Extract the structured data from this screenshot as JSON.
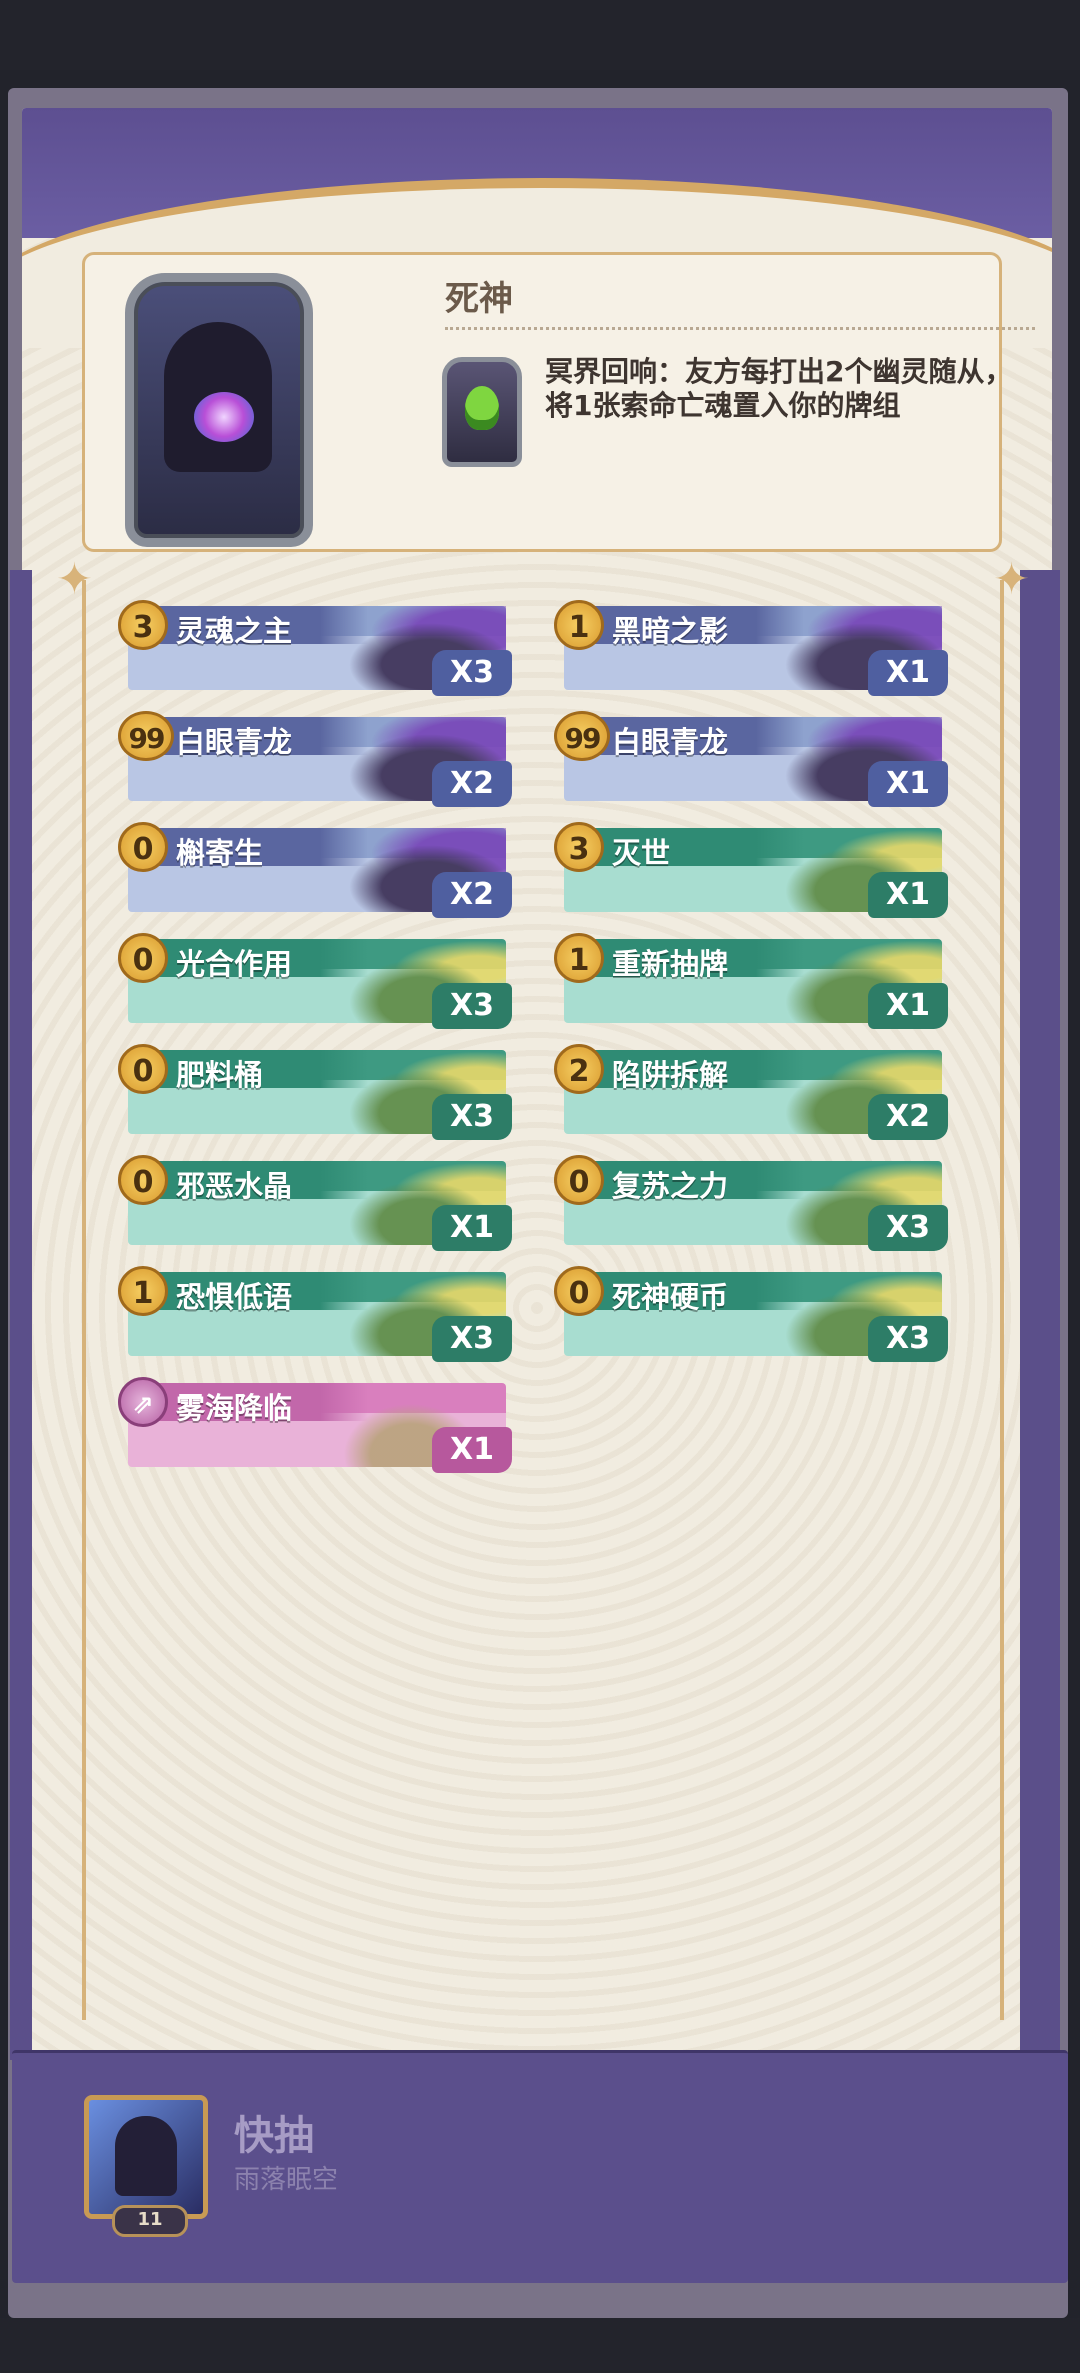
{
  "hero": {
    "name": "死神",
    "description": "冥界回响：友方每打出2个幽灵随从，将1张索命亡魂置入你的牌组"
  },
  "cards": [
    {
      "cost": "3",
      "name": "灵魂之主",
      "count": "X3",
      "type": "purple"
    },
    {
      "cost": "1",
      "name": "黑暗之影",
      "count": "X1",
      "type": "purple"
    },
    {
      "cost": "99",
      "name": "白眼青龙",
      "count": "X2",
      "type": "purple"
    },
    {
      "cost": "99",
      "name": "白眼青龙",
      "count": "X1",
      "type": "purple"
    },
    {
      "cost": "0",
      "name": "槲寄生",
      "count": "X2",
      "type": "purple"
    },
    {
      "cost": "3",
      "name": "灭世",
      "count": "X1",
      "type": "green"
    },
    {
      "cost": "0",
      "name": "光合作用",
      "count": "X3",
      "type": "green"
    },
    {
      "cost": "1",
      "name": "重新抽牌",
      "count": "X1",
      "type": "green"
    },
    {
      "cost": "0",
      "name": "肥料桶",
      "count": "X3",
      "type": "green"
    },
    {
      "cost": "2",
      "name": "陷阱拆解",
      "count": "X2",
      "type": "green"
    },
    {
      "cost": "0",
      "name": "邪恶水晶",
      "count": "X1",
      "type": "green"
    },
    {
      "cost": "0",
      "name": "复苏之力",
      "count": "X3",
      "type": "green"
    },
    {
      "cost": "1",
      "name": "恐惧低语",
      "count": "X3",
      "type": "green"
    },
    {
      "cost": "0",
      "name": "死神硬币",
      "count": "X3",
      "type": "green"
    },
    {
      "cost": "spell-icon",
      "name": "雾海降临",
      "count": "X1",
      "type": "pink"
    }
  ],
  "deck": {
    "name": "快抽",
    "author": "雨落眠空",
    "card_total": "11"
  },
  "colors": {
    "panel_purple": "#5b4f8c",
    "parchment": "#f1ece0",
    "gold": "#d6b27a",
    "minion_blue": "#5a66a0",
    "spell_green": "#2f8b74",
    "special_pink": "#c267aa"
  }
}
